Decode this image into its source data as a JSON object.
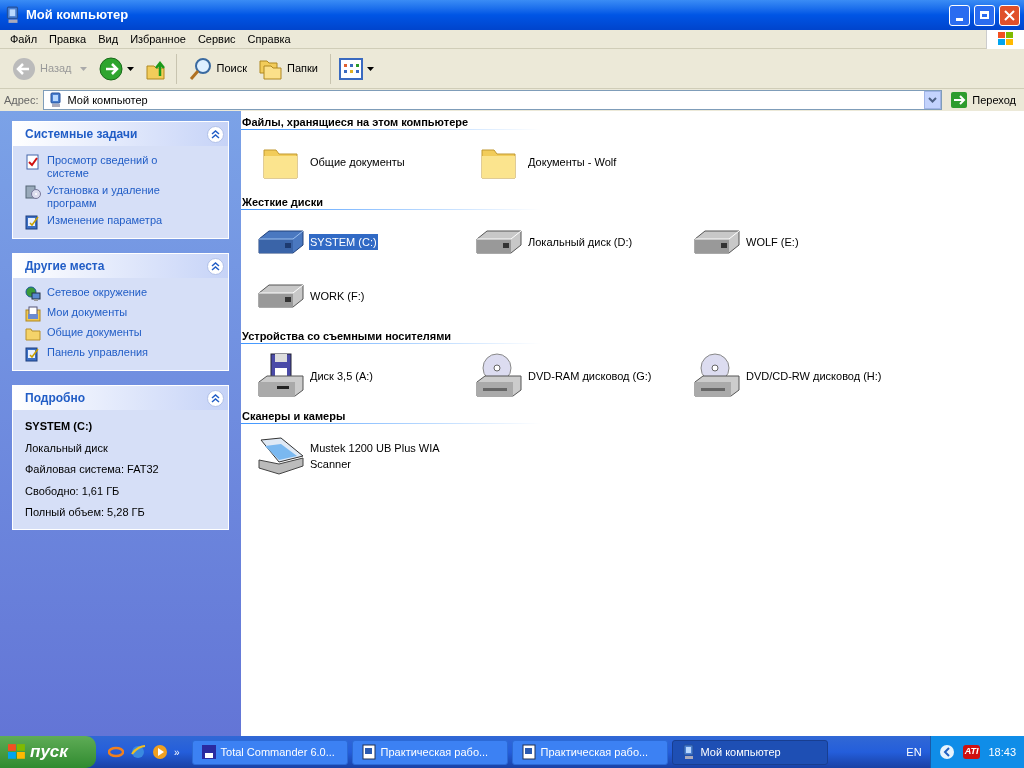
{
  "window": {
    "title": "Мой компьютер"
  },
  "menu": [
    {
      "label": "Файл"
    },
    {
      "label": "Правка"
    },
    {
      "label": "Вид"
    },
    {
      "label": "Избранное"
    },
    {
      "label": "Сервис"
    },
    {
      "label": "Справка"
    }
  ],
  "toolbar": {
    "back": {
      "label": "Назад",
      "disabled": true
    },
    "search": {
      "label": "Поиск"
    },
    "folders": {
      "label": "Папки"
    }
  },
  "address": {
    "label": "Адрес:",
    "value": "Мой компьютер",
    "go": "Переход"
  },
  "sidebar": [
    {
      "title": "Системные задачи",
      "kind": "links",
      "items": [
        {
          "label": "Просмотр сведений о системе",
          "kind": "info"
        },
        {
          "label": "Установка и удаление программ",
          "kind": "install"
        },
        {
          "label": "Изменение параметра",
          "kind": "panel"
        }
      ]
    },
    {
      "title": "Другие места",
      "kind": "links",
      "items": [
        {
          "label": "Сетевое окружение",
          "kind": "network"
        },
        {
          "label": "Мои документы",
          "kind": "docs"
        },
        {
          "label": "Общие документы",
          "kind": "folder"
        },
        {
          "label": "Панель управления",
          "kind": "panel"
        }
      ]
    },
    {
      "title": "Подробно",
      "kind": "details",
      "name": "SYSTEM (C:)",
      "lines": [
        "Локальный диск",
        "Файловая система: FAT32",
        "Свободно: 1,61 ГБ",
        "Полный объем: 5,28 ГБ"
      ]
    }
  ],
  "groups": [
    {
      "title": "Файлы, хранящиеся на этом компьютере",
      "items": [
        {
          "label": "Общие документы",
          "kind": "folder",
          "selected": false
        },
        {
          "label": "Документы - Wolf",
          "kind": "folder",
          "selected": false
        }
      ]
    },
    {
      "title": "Жесткие диски",
      "items": [
        {
          "label": "SYSTEM (C:)",
          "kind": "drive",
          "selected": true
        },
        {
          "label": "Локальный диск (D:)",
          "kind": "drive",
          "selected": false
        },
        {
          "label": "WOLF (E:)",
          "kind": "drive",
          "selected": false
        },
        {
          "label": "WORK (F:)",
          "kind": "drive",
          "selected": false
        }
      ]
    },
    {
      "title": "Устройства со съемными носителями",
      "items": [
        {
          "label": "Диск 3,5 (A:)",
          "kind": "floppy",
          "selected": false
        },
        {
          "label": "DVD-RAM дисковод (G:)",
          "kind": "dvd",
          "selected": false
        },
        {
          "label": "DVD/CD-RW дисковод (H:)",
          "kind": "dvd",
          "selected": false
        }
      ]
    },
    {
      "title": "Сканеры и камеры",
      "items": [
        {
          "label": "Mustek 1200 UB Plus WIA Scanner",
          "kind": "scanner",
          "selected": false
        }
      ]
    }
  ],
  "taskbar": {
    "start": "пуск",
    "quick_more": "»",
    "tasks": [
      {
        "label": "Total Commander 6.0...",
        "kind": "tc",
        "selected": false
      },
      {
        "label": "Практическая рабо...",
        "kind": "word",
        "selected": false
      },
      {
        "label": "Практическая рабо...",
        "kind": "word",
        "selected": false
      },
      {
        "label": "Мой компьютер",
        "kind": "computer",
        "selected": true
      }
    ],
    "lang": "EN",
    "tray_badge": "ATI",
    "clock": "18:43"
  }
}
